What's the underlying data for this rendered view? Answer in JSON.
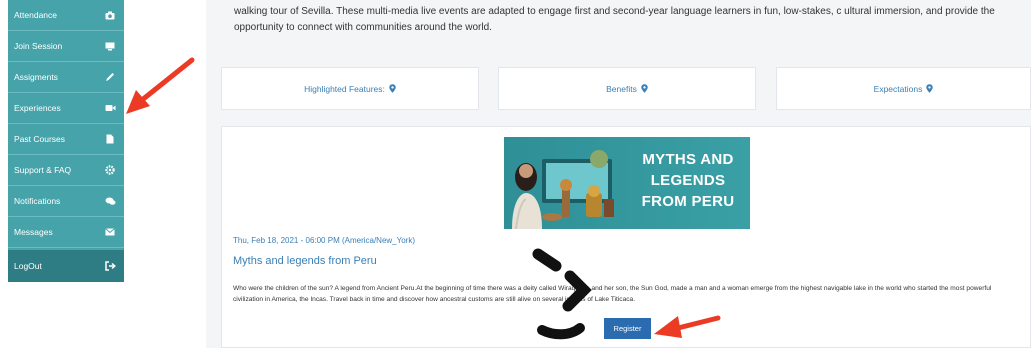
{
  "sidebar": {
    "items": [
      {
        "label": "Attendance",
        "icon": "camera-icon"
      },
      {
        "label": "Join Session",
        "icon": "monitor-icon"
      },
      {
        "label": "Assigments",
        "icon": "pencil-icon"
      },
      {
        "label": "Experiences",
        "icon": "video-icon"
      },
      {
        "label": "Past Courses",
        "icon": "file-icon"
      },
      {
        "label": "Support & FAQ",
        "icon": "gear-icon"
      },
      {
        "label": "Notifications",
        "icon": "chat-icon"
      },
      {
        "label": "Messages",
        "icon": "envelope-icon"
      },
      {
        "label": "LogOut",
        "icon": "sign-out-icon"
      }
    ]
  },
  "intro": {
    "text": "walking tour of Sevilla. These multi-media live events are adapted to engage first and second-year language learners in fun, low-stakes, c ultural immersion, and provide the opportunity to connect with communities around the world."
  },
  "features": [
    {
      "label": "Highlighted Features:"
    },
    {
      "label": "Benefits"
    },
    {
      "label": "Expectations"
    }
  ],
  "event": {
    "banner_text": "MYTHS AND\nLEGENDS\nFROM PERU",
    "date": "Thu, Feb 18, 2021 - 06:00 PM (America/New_York)",
    "title": "Myths and legends from Peru",
    "description": "Who were the children of the sun? A legend from Ancient Peru.At the beginning of time there was a deity called Wiraqocha and her son, the Sun God, made a man and a woman emerge from the highest navigable lake in the world who started the most powerful civilization in America, the Incas. Travel back in time and discover how ancestral customs are still alive on several islands of Lake Titicaca.",
    "register_label": "Register"
  },
  "colors": {
    "sidebar": "#45a3a9",
    "sidebar_logout": "#2f7d84",
    "link": "#3a7fb5",
    "button": "#2b6cb0",
    "arrow": "#ec3b24"
  }
}
